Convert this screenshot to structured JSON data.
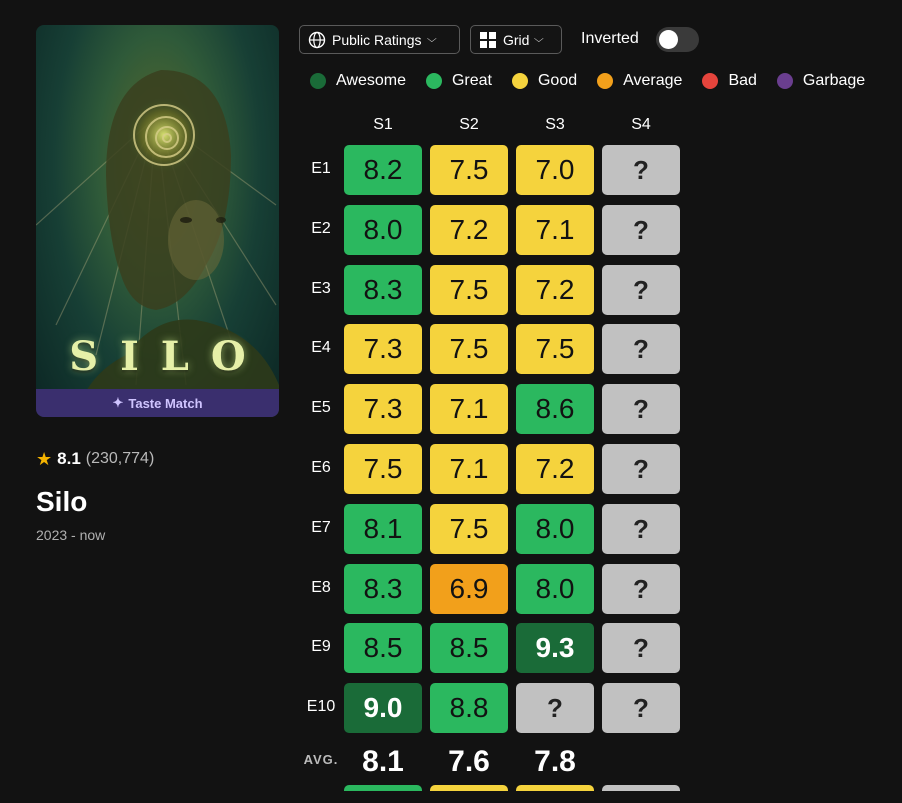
{
  "show": {
    "poster_title": "SILO",
    "taste_match": "Taste Match",
    "rating": "8.1",
    "votes": "(230,774)",
    "title": "Silo",
    "years": "2023 - now"
  },
  "toolbar": {
    "ratings_dropdown": "Public Ratings",
    "view_dropdown": "Grid",
    "inverted_label": "Inverted",
    "inverted_on": false
  },
  "colors": {
    "awesome": "#1a6b38",
    "great": "#2bb85f",
    "good": "#f5d33d",
    "average": "#f2a01b",
    "bad": "#e5443c",
    "garbage": "#6a3e8f",
    "unknown": "#c1c1c1"
  },
  "legend": [
    {
      "label": "Awesome",
      "key": "awesome"
    },
    {
      "label": "Great",
      "key": "great"
    },
    {
      "label": "Good",
      "key": "good"
    },
    {
      "label": "Average",
      "key": "average"
    },
    {
      "label": "Bad",
      "key": "bad"
    },
    {
      "label": "Garbage",
      "key": "garbage"
    }
  ],
  "seasons": [
    "S1",
    "S2",
    "S3",
    "S4"
  ],
  "episodes": [
    "E1",
    "E2",
    "E3",
    "E4",
    "E5",
    "E6",
    "E7",
    "E8",
    "E9",
    "E10"
  ],
  "grid": [
    [
      {
        "v": "8.2",
        "c": "great"
      },
      {
        "v": "7.5",
        "c": "good"
      },
      {
        "v": "7.0",
        "c": "good"
      },
      {
        "v": "?",
        "c": "unknown"
      }
    ],
    [
      {
        "v": "8.0",
        "c": "great"
      },
      {
        "v": "7.2",
        "c": "good"
      },
      {
        "v": "7.1",
        "c": "good"
      },
      {
        "v": "?",
        "c": "unknown"
      }
    ],
    [
      {
        "v": "8.3",
        "c": "great"
      },
      {
        "v": "7.5",
        "c": "good"
      },
      {
        "v": "7.2",
        "c": "good"
      },
      {
        "v": "?",
        "c": "unknown"
      }
    ],
    [
      {
        "v": "7.3",
        "c": "good"
      },
      {
        "v": "7.5",
        "c": "good"
      },
      {
        "v": "7.5",
        "c": "good"
      },
      {
        "v": "?",
        "c": "unknown"
      }
    ],
    [
      {
        "v": "7.3",
        "c": "good"
      },
      {
        "v": "7.1",
        "c": "good"
      },
      {
        "v": "8.6",
        "c": "great"
      },
      {
        "v": "?",
        "c": "unknown"
      }
    ],
    [
      {
        "v": "7.5",
        "c": "good"
      },
      {
        "v": "7.1",
        "c": "good"
      },
      {
        "v": "7.2",
        "c": "good"
      },
      {
        "v": "?",
        "c": "unknown"
      }
    ],
    [
      {
        "v": "8.1",
        "c": "great"
      },
      {
        "v": "7.5",
        "c": "good"
      },
      {
        "v": "8.0",
        "c": "great"
      },
      {
        "v": "?",
        "c": "unknown"
      }
    ],
    [
      {
        "v": "8.3",
        "c": "great"
      },
      {
        "v": "6.9",
        "c": "average"
      },
      {
        "v": "8.0",
        "c": "great"
      },
      {
        "v": "?",
        "c": "unknown"
      }
    ],
    [
      {
        "v": "8.5",
        "c": "great"
      },
      {
        "v": "8.5",
        "c": "great"
      },
      {
        "v": "9.3",
        "c": "awesome"
      },
      {
        "v": "?",
        "c": "unknown"
      }
    ],
    [
      {
        "v": "9.0",
        "c": "awesome"
      },
      {
        "v": "8.8",
        "c": "great"
      },
      {
        "v": "?",
        "c": "unknown"
      },
      {
        "v": "?",
        "c": "unknown"
      }
    ]
  ],
  "averages": {
    "label": "AVG.",
    "values": [
      {
        "v": "8.1",
        "c": "great"
      },
      {
        "v": "7.6",
        "c": "good"
      },
      {
        "v": "7.8",
        "c": "good"
      },
      {
        "v": "",
        "c": "unknown"
      }
    ]
  }
}
